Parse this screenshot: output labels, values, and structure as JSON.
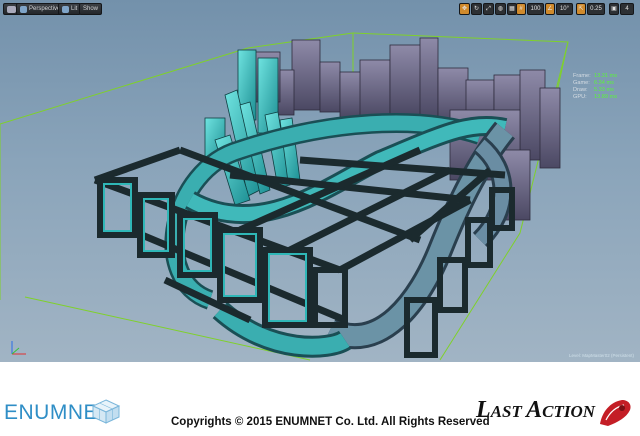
{
  "viewport": {
    "toolbar": {
      "perspective_label": "Perspective",
      "lit_label": "Lit",
      "show_label": "Show"
    },
    "right_toolbar": {
      "grid_snap_value": "100",
      "rotation_snap_value": "10°",
      "scale_snap_value": "0.25",
      "camera_speed_value": "4"
    },
    "stats": [
      {
        "label": "Frame:",
        "value": "13.31 ms"
      },
      {
        "label": "Game:",
        "value": "6.34 ms"
      },
      {
        "label": "Draw:",
        "value": "5.33 ms"
      },
      {
        "label": "GPU:",
        "value": "13.89 ms"
      }
    ],
    "level_text": "Level: MapMaster02 (Persistent)"
  },
  "footer": {
    "brand": "ENUMNET",
    "copyright": "Copyrights © 2015 ENUMNET Co. Ltd. All Rights Reserved",
    "game_title_first": "L",
    "game_title_first_rest": "AST ",
    "game_title_second": "A",
    "game_title_second_rest": "CTION"
  },
  "colors": {
    "sky_top": "#7391ab",
    "teal": "#2fb7b7",
    "dark_frame": "#1b2a2e",
    "stat_value": "#5cf23c",
    "brand_blue": "#2f8ec6",
    "selection_green": "#7fd12a"
  }
}
